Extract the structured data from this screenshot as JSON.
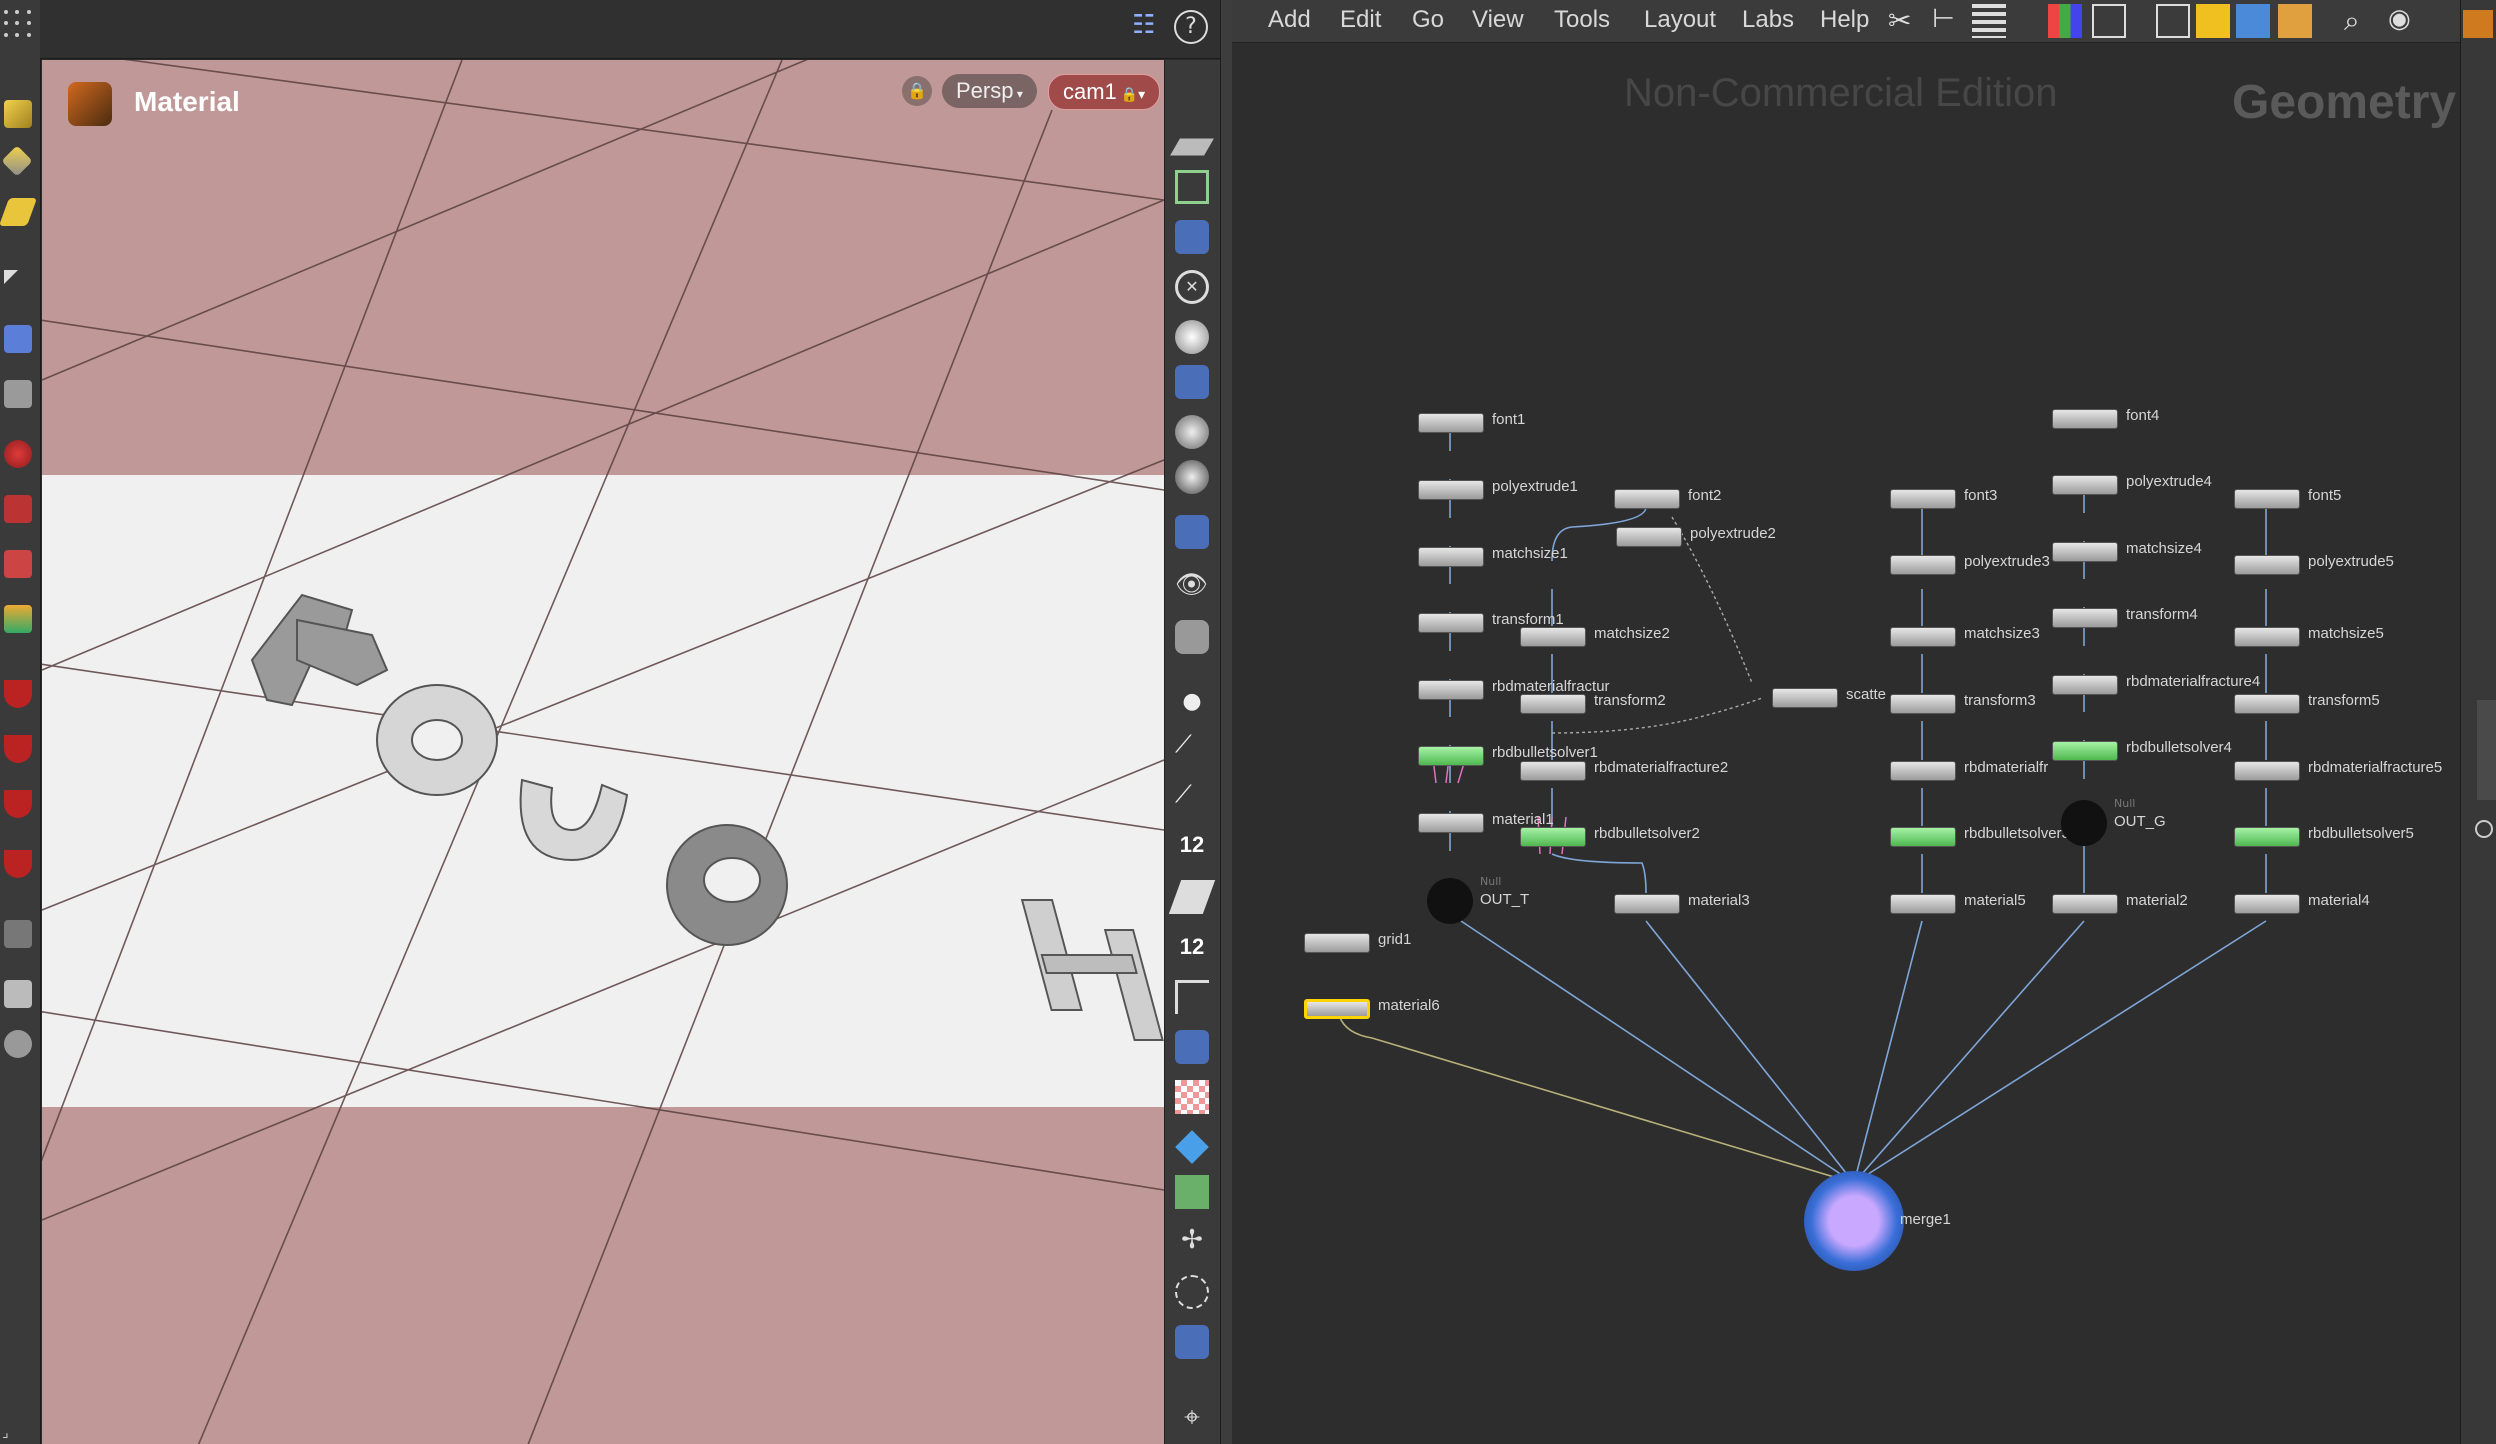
{
  "viewport": {
    "title": "Material",
    "view_mode": "Persp",
    "camera": "cam1",
    "scene_text": "TOUGH",
    "shelf_numbers": [
      "12",
      "12"
    ]
  },
  "menubar": {
    "items": [
      "Add",
      "Edit",
      "Go",
      "View",
      "Tools",
      "Layout",
      "Labs",
      "Help"
    ]
  },
  "network": {
    "edition": "Non-Commercial Edition",
    "context": "Geometry",
    "null_type": "Null",
    "nodes": {
      "font1": "font1",
      "polyextrude1": "polyextrude1",
      "matchsize1": "matchsize1",
      "transform1": "transform1",
      "rbdmaterialfracture1": "rbdmaterialfractur",
      "rbdbulletsolver1": "rbdbulletsolver1",
      "material1": "material1",
      "OUT_T": "OUT_T",
      "font2": "font2",
      "polyextrude2": "polyextrude2",
      "matchsize2": "matchsize2",
      "transform2": "transform2",
      "scatter": "scatte",
      "rbdmaterialfracture2": "rbdmaterialfracture2",
      "rbdbulletsolver2": "rbdbulletsolver2",
      "material3": "material3",
      "font3": "font3",
      "polyextrude3": "polyextrude3",
      "matchsize3": "matchsize3",
      "transform3": "transform3",
      "rbdmaterialfracture3": "rbdmaterialfr",
      "rbdbulletsolver3": "rbdbulletsolver3",
      "material5": "material5",
      "font4": "font4",
      "polyextrude4": "polyextrude4",
      "matchsize4": "matchsize4",
      "transform4": "transform4",
      "rbdmaterialfracture4": "rbdmaterialfracture4",
      "rbdbulletsolver4": "rbdbulletsolver4",
      "OUT_G": "OUT_G",
      "material2": "material2",
      "font5": "font5",
      "polyextrude5": "polyextrude5",
      "matchsize5": "matchsize5",
      "transform5": "transform5",
      "rbdmaterialfracture5": "rbdmaterialfracture5",
      "rbdbulletsolver5": "rbdbulletsolver5",
      "material4": "material4",
      "grid1": "grid1",
      "material6": "material6",
      "merge1": "merge1"
    }
  },
  "colors": {
    "viewport_bg": "#c09898",
    "ground_plane": "#f0f0f0",
    "solver_node": "#7fe07f",
    "selected_node": "#ffd400",
    "merge_node": "#3a6fd8",
    "wire": "#7fa6d8"
  }
}
